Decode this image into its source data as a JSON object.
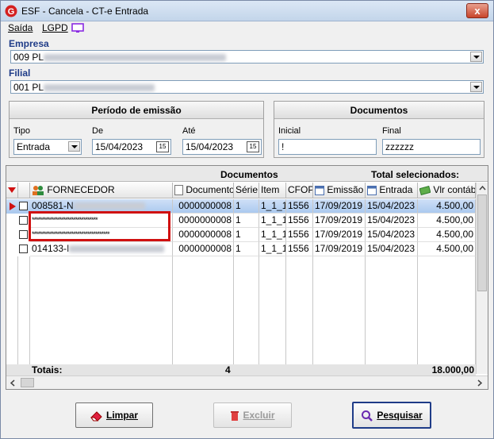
{
  "window": {
    "title": "ESF - Cancela - CT-e Entrada",
    "close_label": "x"
  },
  "menu": {
    "saida": "Saída",
    "lgpd": "LGPD"
  },
  "empresa": {
    "label": "Empresa",
    "value": "009 PL"
  },
  "filial": {
    "label": "Filial",
    "value": "001 PL"
  },
  "periodo": {
    "header": "Período de emissão",
    "tipo_label": "Tipo",
    "tipo_value": "Entrada",
    "de_label": "De",
    "de_value": "15/04/2023",
    "ate_label": "Até",
    "ate_value": "15/04/2023"
  },
  "documentos": {
    "header": "Documentos",
    "inicial_label": "Inicial",
    "inicial_value": "!",
    "final_label": "Final",
    "final_value": "zzzzzz"
  },
  "grid": {
    "band_documentos": "Documentos",
    "band_total": "Total selecionados:",
    "columns": [
      "FORNECEDOR",
      "Documento",
      "Série",
      "Item",
      "CFOP",
      "Emissão",
      "Entrada",
      "Vlr contábil"
    ],
    "rows": [
      {
        "fornecedor": "008581-N",
        "documento": "0000000008",
        "serie": "1",
        "item": "1_1_1",
        "cfop": "1556",
        "emissao": "17/09/2019",
        "entrada": "15/04/2023",
        "valor": "4.500,00"
      },
      {
        "fornecedor": "*********************************",
        "documento": "0000000008",
        "serie": "1",
        "item": "1_1_1",
        "cfop": "1556",
        "emissao": "17/09/2019",
        "entrada": "15/04/2023",
        "valor": "4.500,00"
      },
      {
        "fornecedor": "***************************************",
        "documento": "0000000008",
        "serie": "1",
        "item": "1_1_1",
        "cfop": "1556",
        "emissao": "17/09/2019",
        "entrada": "15/04/2023",
        "valor": "4.500,00"
      },
      {
        "fornecedor": "014133-I",
        "documento": "0000000008",
        "serie": "1",
        "item": "1_1_1",
        "cfop": "1556",
        "emissao": "17/09/2019",
        "entrada": "15/04/2023",
        "valor": "4.500,00"
      }
    ],
    "totals_label": "Totais:",
    "totals_count": "4",
    "totals_value": "18.000,00"
  },
  "buttons": {
    "limpar": "Limpar",
    "excluir": "Excluir",
    "pesquisar": "Pesquisar"
  },
  "colors": {
    "label_blue": "#1f3c88",
    "highlight_red": "#d01010",
    "selected_row": "#a9c8ee"
  }
}
